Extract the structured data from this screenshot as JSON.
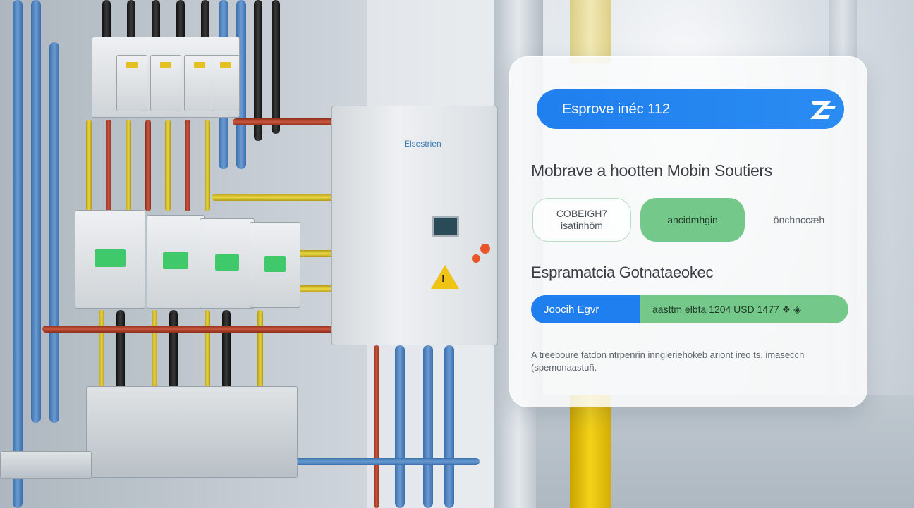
{
  "card": {
    "search_label": "Esprove inéc 112",
    "logo_icon": "z-logo-icon",
    "headline": "Mobrave a hootten Mobin Soutiers",
    "options": [
      {
        "line1": "COBEIGH7",
        "line2": "isatinhöm"
      },
      {
        "line1": "ancidmhgin"
      },
      {
        "line1": "önchnccæh"
      }
    ],
    "subheading": "Espramatcia Gotnataeokec",
    "bar": {
      "left_label": "Joocih Egvr",
      "right_label": "aasttm elbta 1204 USD 1477 ❖ ◈"
    },
    "footnote": "A treeboure fatdon ntrpenrin inngleriehokeb ariont ireo ts, imasecch (spemonaastuñ."
  },
  "background": {
    "cabinet_brand": "Elsestrien",
    "accent_blue": "#1f7fee",
    "accent_green": "#74c98a"
  }
}
